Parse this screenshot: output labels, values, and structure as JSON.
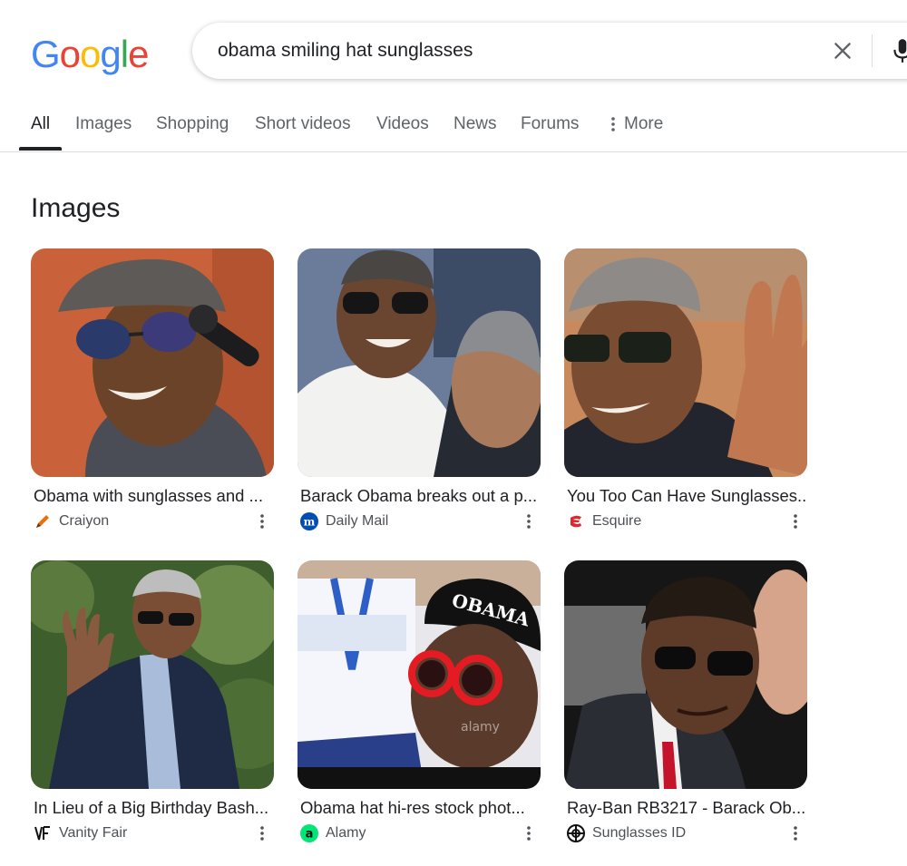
{
  "header": {
    "logo_letters": [
      "G",
      "o",
      "o",
      "g",
      "l",
      "e"
    ],
    "logo_colors": [
      "#4285F4",
      "#EA4335",
      "#FBBC05",
      "#4285F4",
      "#34A853",
      "#EA4335"
    ],
    "search_query": "obama smiling hat sunglasses"
  },
  "tabs": [
    {
      "label": "All",
      "active": true
    },
    {
      "label": "Images",
      "active": false
    },
    {
      "label": "Shopping",
      "active": false
    },
    {
      "label": "Short videos",
      "active": false
    },
    {
      "label": "Videos",
      "active": false
    },
    {
      "label": "News",
      "active": false
    },
    {
      "label": "Forums",
      "active": false
    },
    {
      "label": "More",
      "active": false
    }
  ],
  "images_section": {
    "title": "Images",
    "results": [
      {
        "caption": "Obama with sunglasses and ...",
        "source": "Craiyon",
        "favicon": "pencil-icon"
      },
      {
        "caption": "Barack Obama breaks out a p...",
        "source": "Daily Mail",
        "favicon": "daily-mail-icon"
      },
      {
        "caption": "You Too Can Have Sunglasses...",
        "source": "Esquire",
        "favicon": "esquire-icon"
      },
      {
        "caption": "In Lieu of a Big Birthday Bash...",
        "source": "Vanity Fair",
        "favicon": "vanity-fair-icon"
      },
      {
        "caption": "Obama hat hi-res stock phot...",
        "source": "Alamy",
        "favicon": "alamy-icon"
      },
      {
        "caption": "Ray-Ban RB3217 - Barack Ob...",
        "source": "Sunglasses ID",
        "favicon": "globe-icon"
      }
    ],
    "image_texts": {
      "hat_text": "OBAMA",
      "watermark": "alamy"
    }
  },
  "colors": {
    "text_primary": "#202124",
    "text_secondary": "#5f6368",
    "source_text": "#4d5156",
    "divider": "#dadce0"
  }
}
